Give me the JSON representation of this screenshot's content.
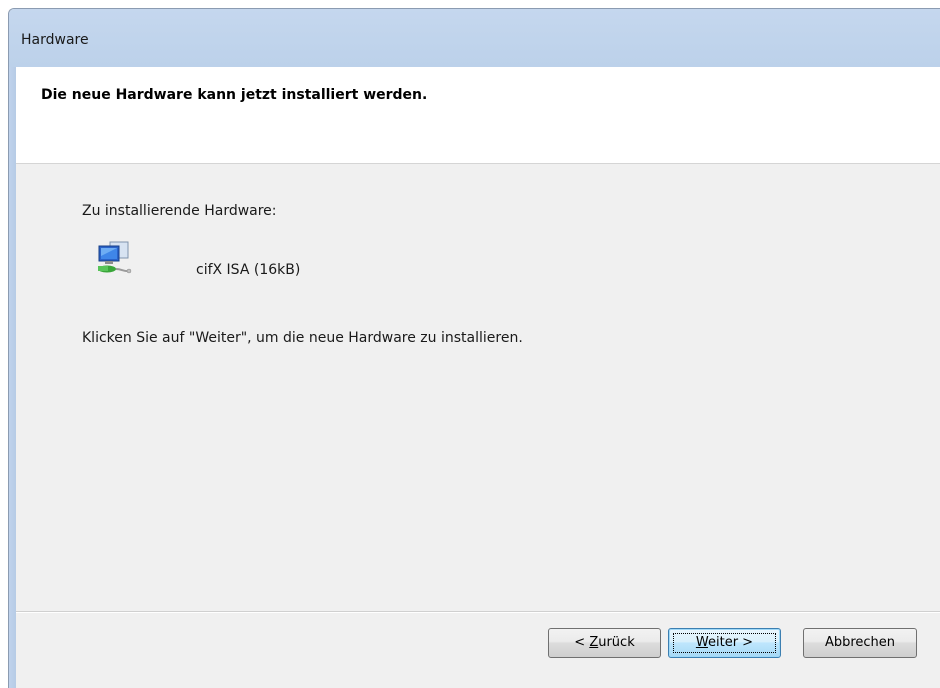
{
  "window": {
    "title": "Hardware"
  },
  "header": {
    "title": "Die neue Hardware kann jetzt installiert werden."
  },
  "content": {
    "hardware_label": "Zu installierende Hardware:",
    "device_icon": "network-adapter-icon",
    "device_name": "cifX ISA (16kB)",
    "instruction": "Klicken Sie auf \"Weiter\", um die neue Hardware zu installieren."
  },
  "buttons": {
    "back_prefix": "< ",
    "back_mnemonic": "Z",
    "back_rest": "urück",
    "next_mnemonic": "W",
    "next_rest": "eiter >",
    "cancel": "Abbrechen"
  },
  "colors": {
    "titlebar": "#c5d7ee",
    "dialog_bg": "#f0f0f0",
    "default_button_border": "#3c7fb1"
  }
}
